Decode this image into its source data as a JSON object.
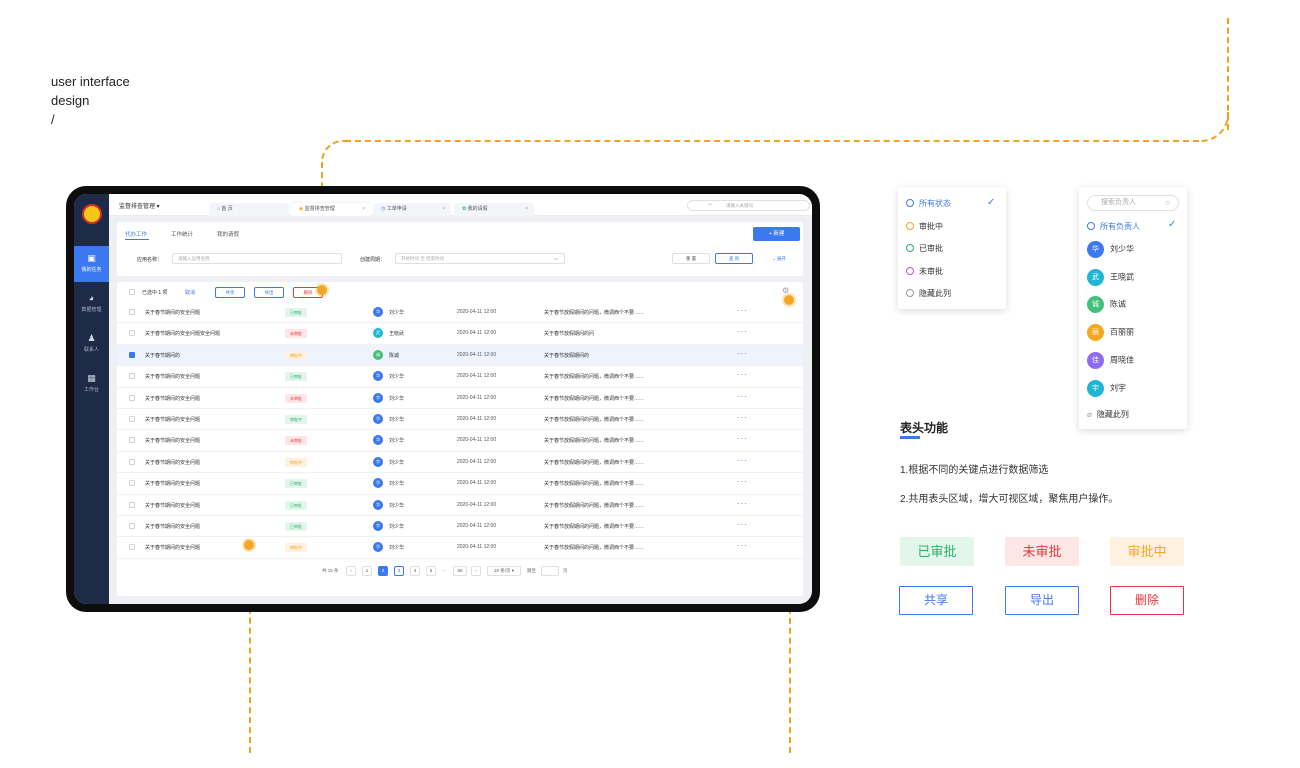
{
  "brand": {
    "line1": "user interface",
    "line2": "design",
    "line3": "/"
  },
  "app": {
    "system_title": "监督排查管理",
    "tabs": [
      {
        "label": "首 页"
      },
      {
        "label": "监督排查管理"
      },
      {
        "label": "工单申请"
      },
      {
        "label": "我的请假"
      }
    ],
    "search_placeholder": "请输入关键词",
    "notification_count": "9",
    "user_avatar": "少华",
    "sidebar": [
      {
        "label": "我的任务"
      },
      {
        "label": "数据管理"
      },
      {
        "label": "联系人"
      },
      {
        "label": "工作台"
      }
    ],
    "subtabs": [
      "代办工作",
      "工作统计",
      "我的请假"
    ],
    "new_button": "+ 新建",
    "filter": {
      "app_name_label": "应用名称：",
      "app_name_placeholder": "请输入应用名称",
      "period_label": "创建周期：",
      "period_placeholder": "开始时间 至 结束时间",
      "reset": "重 置",
      "query": "查 询",
      "expand": "展开"
    },
    "selection": {
      "text": "已选中 1 项",
      "cancel": "取消",
      "share": "共享",
      "export": "导出",
      "delete": "删除"
    },
    "rows": [
      {
        "name": "关于春节期间的安全问题",
        "status": "已审批",
        "tone": "green",
        "person": "刘少华",
        "avatar": "华",
        "avcolor": "#3c78f0",
        "time": "2020-04-11  12:00",
        "desc": "关于春节放假期间的问题，微调西个不要……",
        "hl": false
      },
      {
        "name": "关于春节期间的安全问题安全问题",
        "status": "未审批",
        "tone": "red",
        "person": "王晓武",
        "avatar": "武",
        "avcolor": "#1fb5d4",
        "time": "2020-04-11  12:00",
        "desc": "关于春节放假期间的问",
        "hl": false
      },
      {
        "name": "关于春节期间的",
        "status": "审批中",
        "tone": "orange",
        "person": "陈诚",
        "avatar": "诚",
        "avcolor": "#45c07a",
        "time": "2020-04-11  12:00",
        "desc": "关于春节放假期间的",
        "hl": true
      },
      {
        "name": "关于春节期间的安全问题",
        "status": "已审批",
        "tone": "green",
        "person": "刘少华",
        "avatar": "华",
        "avcolor": "#3c78f0",
        "time": "2020-04-11  12:00",
        "desc": "关于春节放假期间的问题，微调西个不要……",
        "hl": false
      },
      {
        "name": "关于春节期间的安全问题",
        "status": "未审批",
        "tone": "red",
        "person": "刘少华",
        "avatar": "华",
        "avcolor": "#3c78f0",
        "time": "2020-04-11  12:00",
        "desc": "关于春节放假期间的问题，微调西个不要……",
        "hl": false
      },
      {
        "name": "关于春节期间的安全问题",
        "status": "审批中",
        "tone": "green",
        "person": "刘少华",
        "avatar": "华",
        "avcolor": "#3c78f0",
        "time": "2020-04-11  12:00",
        "desc": "关于春节放假期间的问题，微调西个不要……",
        "hl": false
      },
      {
        "name": "关于春节期间的安全问题",
        "status": "未审批",
        "tone": "red",
        "person": "刘少华",
        "avatar": "华",
        "avcolor": "#3c78f0",
        "time": "2020-04-11  12:00",
        "desc": "关于春节放假期间的问题，微调西个不要……",
        "hl": false
      },
      {
        "name": "关于春节期间的安全问题",
        "status": "审批中",
        "tone": "orange",
        "person": "刘少华",
        "avatar": "华",
        "avcolor": "#3c78f0",
        "time": "2020-04-11  12:00",
        "desc": "关于春节放假期间的问题，微调西个不要……",
        "hl": false
      },
      {
        "name": "关于春节期间的安全问题",
        "status": "已审批",
        "tone": "green",
        "person": "刘少华",
        "avatar": "华",
        "avcolor": "#3c78f0",
        "time": "2020-04-11  12:00",
        "desc": "关于春节放假期间的问题，微调西个不要……",
        "hl": false
      },
      {
        "name": "关于春节期间的安全问题",
        "status": "已审批",
        "tone": "green",
        "person": "刘少华",
        "avatar": "华",
        "avcolor": "#3c78f0",
        "time": "2020-04-11  12:00",
        "desc": "关于春节放假期间的问题，微调西个不要……",
        "hl": false
      },
      {
        "name": "关于春节期间的安全问题",
        "status": "已审批",
        "tone": "green",
        "person": "刘少华",
        "avatar": "华",
        "avcolor": "#3c78f0",
        "time": "2020-04-11  12:00",
        "desc": "关于春节放假期间的问题，微调西个不要……",
        "hl": false
      },
      {
        "name": "关于春节期间的安全问题",
        "status": "审批中",
        "tone": "orange",
        "person": "刘少华",
        "avatar": "华",
        "avcolor": "#3c78f0",
        "time": "2020-04-11  12:00",
        "desc": "关于春节放假期间的问题，微调西个不要……",
        "hl": false
      }
    ],
    "pager": {
      "total": "共 15 条",
      "pages": [
        "1",
        "2",
        "3",
        "4",
        "5",
        "···",
        "50"
      ],
      "page_size": "10 条/页",
      "goto": "跳至",
      "page_unit": "页"
    }
  },
  "status_dropdown": {
    "items": [
      {
        "label": "所有状态",
        "selected": true,
        "color": "#3c78f0"
      },
      {
        "label": "审批中",
        "selected": false,
        "color": "#f5a623"
      },
      {
        "label": "已审批",
        "selected": false,
        "color": "#27b16a"
      },
      {
        "label": "未审批",
        "selected": false,
        "color": "#c54fd6"
      },
      {
        "label": "隐藏此列",
        "selected": false,
        "color": "#999999"
      }
    ]
  },
  "owner_dropdown": {
    "search_placeholder": "搜索负责人",
    "all_label": "所有负责人",
    "people": [
      {
        "name": "刘少华",
        "avatar": "华",
        "color": "#3c78f0"
      },
      {
        "name": "王晓武",
        "avatar": "武",
        "color": "#1fb5d4"
      },
      {
        "name": "陈诚",
        "avatar": "诚",
        "color": "#45c07a"
      },
      {
        "name": "百丽丽",
        "avatar": "丽",
        "color": "#f5a623"
      },
      {
        "name": "周晓佳",
        "avatar": "佳",
        "color": "#8e6cf0"
      },
      {
        "name": "刘宇",
        "avatar": "宇",
        "color": "#1fb5d4"
      }
    ],
    "hide_label": "隐藏此列"
  },
  "feature": {
    "title": "表头功能",
    "line1": "1.根据不同的关键点进行数据筛选",
    "line2": "2.共用表头区域，增大可视区域，聚焦用户操作。"
  },
  "legend": {
    "tag_approved": "已审批",
    "tag_rejected": "未审批",
    "tag_pending": "审批中",
    "btn_share": "共享",
    "btn_export": "导出",
    "btn_delete": "删除"
  },
  "colors": {
    "primary": "#3c78f0",
    "annotation": "#f0a41e",
    "green": "#27b16a",
    "red": "#e8383d",
    "orange": "#f5a623",
    "sidebar": "#1d2b48"
  }
}
